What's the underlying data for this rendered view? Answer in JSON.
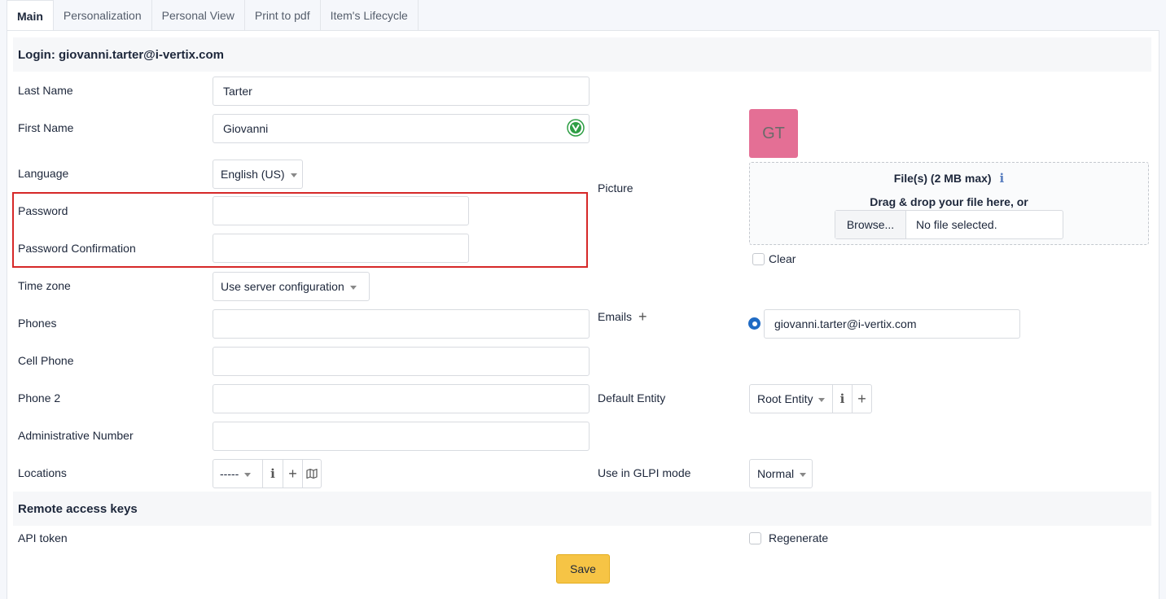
{
  "tabs": [
    "Main",
    "Personalization",
    "Personal View",
    "Print to pdf",
    "Item's Lifecycle"
  ],
  "login_header": "Login: giovanni.tarter@i-vertix.com",
  "fields": {
    "last_name": {
      "label": "Last Name",
      "value": "Tarter"
    },
    "first_name": {
      "label": "First Name",
      "value": "Giovanni"
    },
    "language": {
      "label": "Language",
      "value": "English (US)"
    },
    "password": {
      "label": "Password",
      "value": ""
    },
    "password_confirmation": {
      "label": "Password Confirmation",
      "value": ""
    },
    "time_zone": {
      "label": "Time zone",
      "value": "Use server configuration"
    },
    "phones": {
      "label": "Phones",
      "value": ""
    },
    "cell_phone": {
      "label": "Cell Phone",
      "value": ""
    },
    "phone2": {
      "label": "Phone 2",
      "value": ""
    },
    "administrative_number": {
      "label": "Administrative Number",
      "value": ""
    },
    "locations": {
      "label": "Locations",
      "value": "-----"
    }
  },
  "picture": {
    "label": "Picture",
    "initials": "GT",
    "initials_bg": "#e46f95",
    "file_max": "File(s) (2 MB max)",
    "drag_text": "Drag & drop your file here, or",
    "browse_label": "Browse...",
    "no_file": "No file selected.",
    "clear_label": "Clear"
  },
  "emails": {
    "label": "Emails",
    "value": "giovanni.tarter@i-vertix.com"
  },
  "default_entity": {
    "label": "Default Entity",
    "value": "Root Entity"
  },
  "glpi_mode": {
    "label": "Use in GLPI mode",
    "value": "Normal"
  },
  "remote_access": {
    "header": "Remote access keys",
    "api_token_label": "API token",
    "regenerate_label": "Regenerate"
  },
  "save_label": "Save",
  "colors": {
    "accent": "#206bc4",
    "save": "#f6c445",
    "highlight": "#d62828"
  }
}
